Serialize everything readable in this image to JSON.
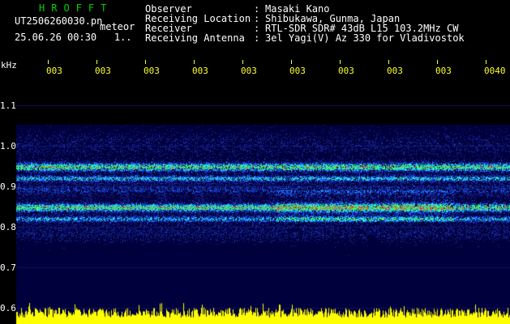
{
  "header": {
    "brand": "HROFFT",
    "filename": "UT2506260030.pn",
    "meteor_label": "meteor",
    "timestamp": "25.06.26 00:30",
    "timestamp_suffix": "1..",
    "info": [
      {
        "label": "Observer",
        "value": "Masaki Kano"
      },
      {
        "label": "Receiving Location",
        "value": "Shibukawa, Gunma, Japan"
      },
      {
        "label": "Receiver",
        "value": "RTL-SDR SDR# 43dB L15 103.2MHz CW"
      },
      {
        "label": "Receiving Antenna",
        "value": "3el Yagi(V) Az 330 for Vladivostok"
      }
    ]
  },
  "axis": {
    "unit": "kHz",
    "y_ticks": [
      "1.1",
      "1.0",
      "0.9",
      "0.8",
      "0.7",
      "0.6"
    ],
    "x_ticks": [
      "003",
      "003",
      "003",
      "003",
      "003",
      "003",
      "003",
      "003",
      "003",
      "0040"
    ]
  },
  "colors": {
    "header_text": "#ffffff",
    "brand": "#00d000",
    "axis_time": "#ffff30",
    "background": "#000000",
    "plot_bg": "#00004a",
    "power_trace": "#ffff00"
  }
}
